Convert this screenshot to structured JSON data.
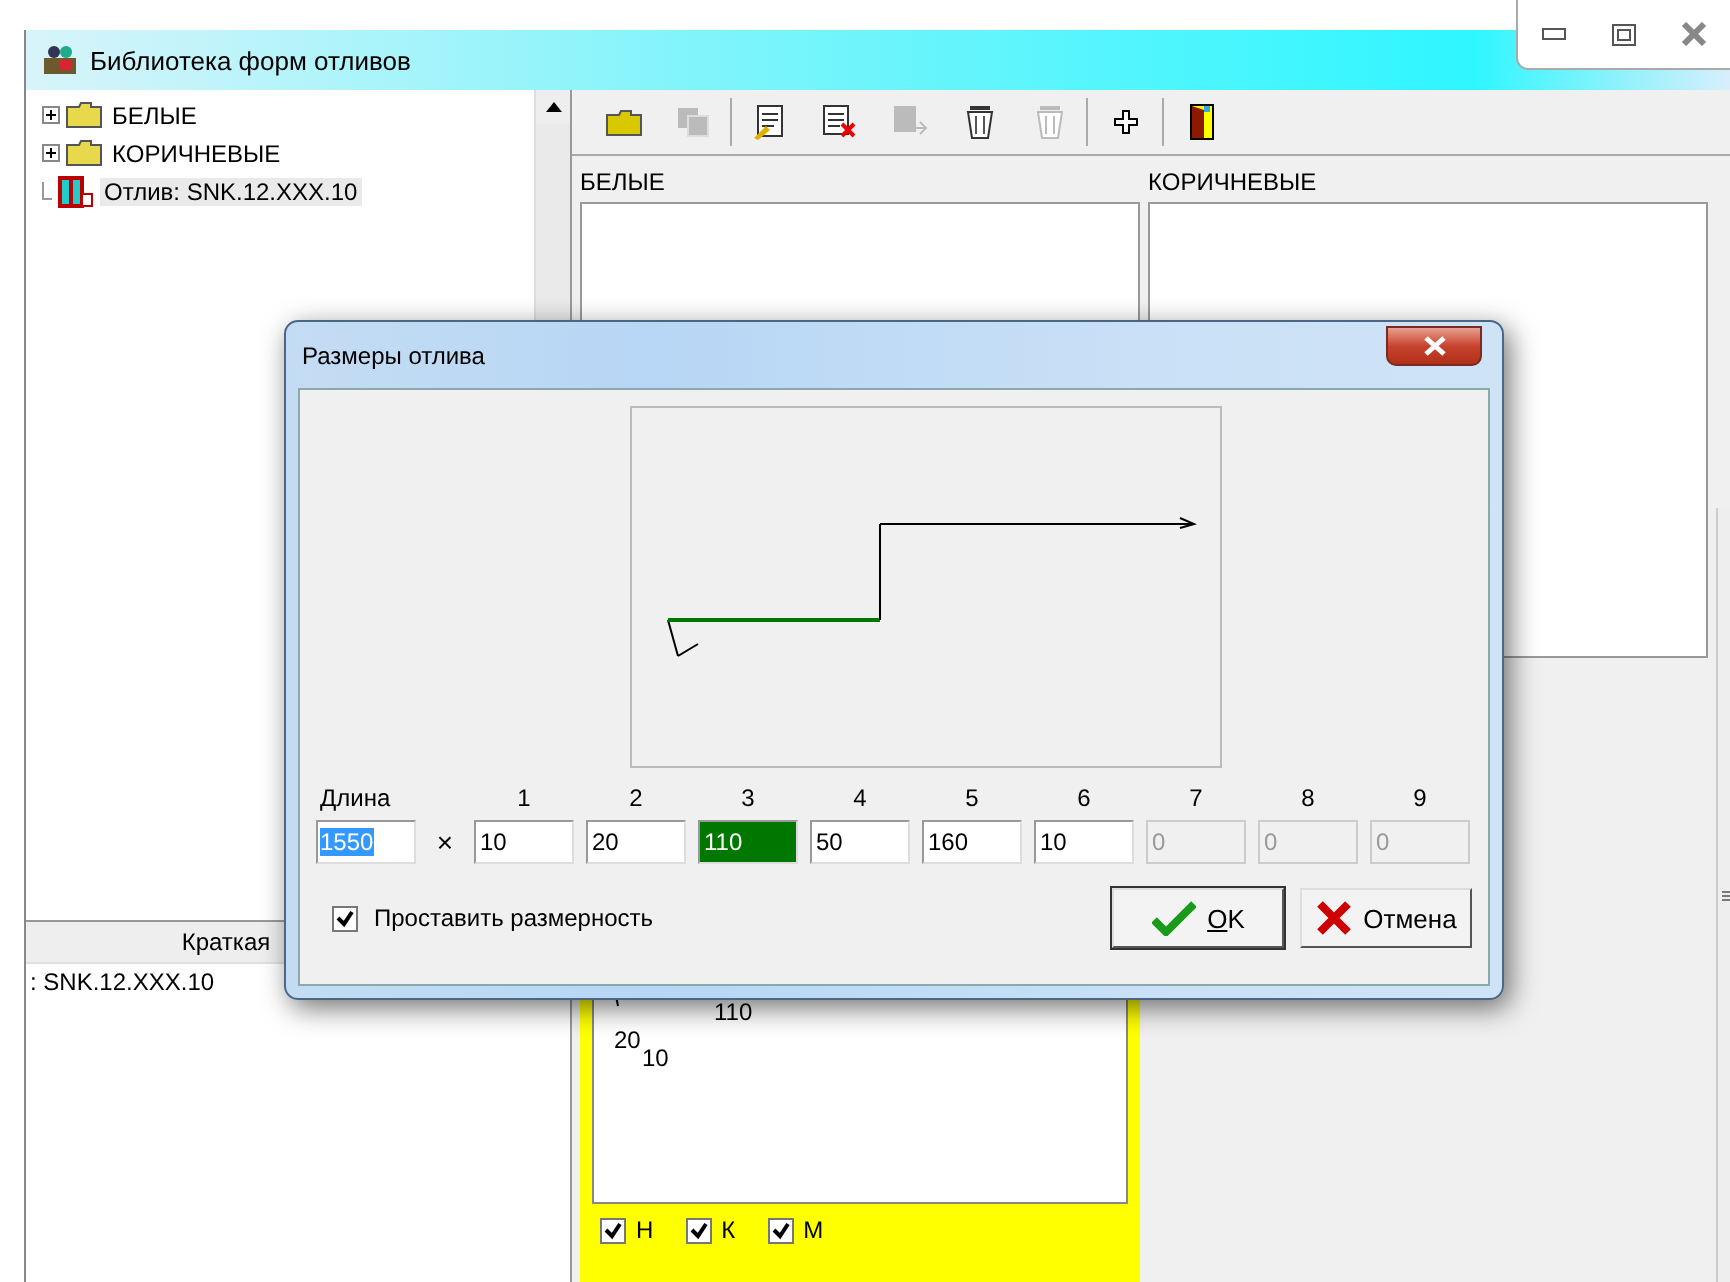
{
  "window": {
    "title": "Библиотека форм отливов"
  },
  "tree": [
    {
      "label": "БЕЛЫЕ",
      "kind": "folder",
      "expanded": false,
      "selected": false
    },
    {
      "label": "КОРИЧНЕВЫЕ",
      "kind": "folder",
      "expanded": false,
      "selected": false
    },
    {
      "label": "Отлив: SNK.12.XXX.10",
      "kind": "item",
      "selected": true
    }
  ],
  "details": {
    "column_header": "Краткая",
    "rows": [
      ": SNK.12.XXX.10"
    ]
  },
  "toolbar": [
    {
      "kind": "folder",
      "disabled": false
    },
    {
      "kind": "copy",
      "disabled": true
    },
    {
      "kind": "separator"
    },
    {
      "kind": "edit",
      "disabled": false
    },
    {
      "kind": "delete-doc",
      "disabled": false
    },
    {
      "kind": "move-doc",
      "disabled": true
    },
    {
      "kind": "bucket",
      "disabled": false
    },
    {
      "kind": "bucket",
      "disabled": true
    },
    {
      "kind": "separator"
    },
    {
      "kind": "plus",
      "disabled": false
    },
    {
      "kind": "separator"
    },
    {
      "kind": "exit",
      "disabled": false
    }
  ],
  "panels": [
    {
      "title": "БЕЛЫЕ"
    },
    {
      "title": "КОРИЧНЕВЫЕ"
    }
  ],
  "preview": {
    "labels": [
      "110",
      "20",
      "10"
    ],
    "checks": [
      {
        "label": "Н",
        "checked": true
      },
      {
        "label": "К",
        "checked": true
      },
      {
        "label": "М",
        "checked": true
      }
    ]
  },
  "dialog": {
    "title": "Размеры отлива",
    "length": {
      "label": "Длина",
      "value": "1550"
    },
    "times": "×",
    "segments": [
      {
        "label": "1",
        "value": "10",
        "selected": false,
        "disabled": false
      },
      {
        "label": "2",
        "value": "20",
        "selected": false,
        "disabled": false
      },
      {
        "label": "3",
        "value": "110",
        "selected": true,
        "disabled": false
      },
      {
        "label": "4",
        "value": "50",
        "selected": false,
        "disabled": false
      },
      {
        "label": "5",
        "value": "160",
        "selected": false,
        "disabled": false
      },
      {
        "label": "6",
        "value": "10",
        "selected": false,
        "disabled": false
      },
      {
        "label": "7",
        "value": "0",
        "selected": false,
        "disabled": true
      },
      {
        "label": "8",
        "value": "0",
        "selected": false,
        "disabled": true
      },
      {
        "label": "9",
        "value": "0",
        "selected": false,
        "disabled": true
      }
    ],
    "dimension_checkbox": {
      "label": "Проставить размерность",
      "checked": true
    },
    "buttons": [
      {
        "label": "OK",
        "kind": "ok"
      },
      {
        "label": "Отмена",
        "kind": "cancel"
      }
    ]
  }
}
